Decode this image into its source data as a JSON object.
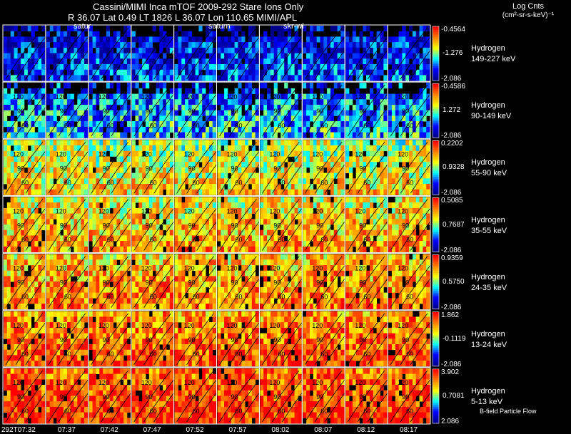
{
  "header": {
    "title": "Cassini/MIMI Inca mTOF  2009-292   Stare    Ions Only",
    "subtitle": "R          36.07 Lat 0.49 LT 1826 L        36.07 Lon        110.65  MIMI/APL",
    "tag_left": "satur",
    "tag_mid": "saturn",
    "tag_right": "skr-wl"
  },
  "units": {
    "title": "Log Cnts",
    "sub": "(cm²-sr-s-keV)⁻¹"
  },
  "footer": {
    "flow_label": "B-field Particle Flow"
  },
  "colors": {
    "background": "#000000",
    "colormap": [
      "#00008b",
      "#0000ff",
      "#00ffff",
      "#ffff00",
      "#ff8000",
      "#ff0000"
    ]
  },
  "chart_data": {
    "type": "heatmap",
    "title": "Cassini/MIMI Inca mTOF  2009-292   Stare    Ions Only",
    "x_ticks": [
      "292T07:32",
      "07:37",
      "07:42",
      "07:47",
      "07:52",
      "07:57",
      "08:02",
      "08:07",
      "08:12",
      "08:17"
    ],
    "contour_labels": [
      "120",
      "90",
      "60"
    ],
    "rows": [
      {
        "species": "Hydrogen",
        "energy": "149-227 keV",
        "max": "-0.4564",
        "mid": "-1.276",
        "min": "-2.086",
        "level": 0.18
      },
      {
        "species": "Hydrogen",
        "energy": "90-149 keV",
        "max": "-0.4586",
        "mid": "1.272",
        "min": "-2.086",
        "level": 0.32
      },
      {
        "species": "Hydrogen",
        "energy": "55-90 keV",
        "max": "0.2202",
        "mid": "0.9328",
        "min": "-2.086",
        "level": 0.62
      },
      {
        "species": "Hydrogen",
        "energy": "35-55 keV",
        "max": "0.5085",
        "mid": "0.7687",
        "min": "-2.086",
        "level": 0.7
      },
      {
        "species": "Hydrogen",
        "energy": "24-35 keV",
        "max": "0.9359",
        "mid": "0.5750",
        "min": "-2.086",
        "level": 0.76
      },
      {
        "species": "Hydrogen",
        "energy": "13-24 keV",
        "max": "1.862",
        "mid": "-0.1119",
        "min": "-2.086",
        "level": 0.83
      },
      {
        "species": "Hydrogen",
        "energy": "5-13 keV",
        "max": "3.902",
        "mid": "0.7081",
        "min": "2.086",
        "level": 0.9
      }
    ]
  }
}
